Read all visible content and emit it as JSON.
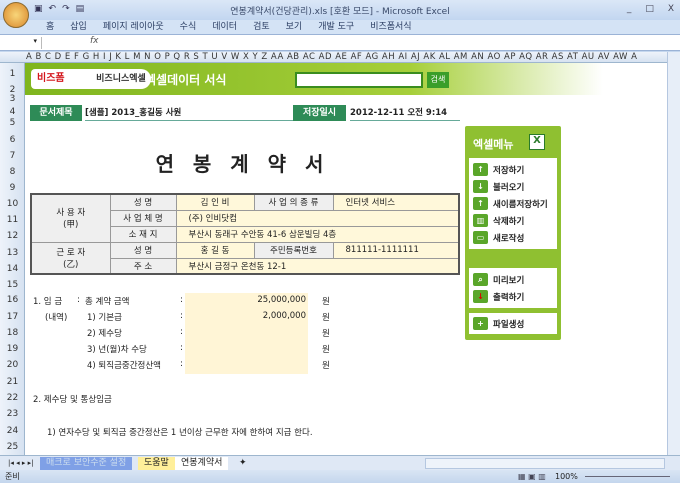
{
  "window": {
    "title": "연봉계약서(건당관리).xls  [호환 모드] - Microsoft Excel",
    "controls": [
      "_",
      "□",
      "X"
    ]
  },
  "ribbon": {
    "tabs": [
      "홈",
      "삽입",
      "페이지 레이아웃",
      "수식",
      "데이터",
      "검토",
      "보기",
      "개발 도구",
      "비즈폼서식"
    ]
  },
  "formula_bar": {
    "fx": "fx",
    "value": ""
  },
  "columns": "A B C D E F G H I J K L M N O P Q R S T U V W X Y Z AA AB AC AD AE AF AG AH AI AJ AK AL AM AN AO AP AQ AR AS AT AU AV AW A",
  "rows": [
    "1",
    "2",
    "3",
    "4",
    "5",
    "6",
    "7",
    "8",
    "9",
    "10",
    "11",
    "12",
    "13",
    "14",
    "15",
    "16",
    "17",
    "18",
    "19",
    "20",
    "21",
    "22",
    "23",
    "24",
    "25"
  ],
  "banner": {
    "logo1": "비즈폼",
    "logo2": "비즈니스엑셀",
    "title": "엑셀데이터 서식",
    "search_placeholder": "",
    "search_button": "검색"
  },
  "doc_info": {
    "title_label": "문서제목",
    "title_value": "[샘플] 2013_홍길동 사원",
    "saved_label": "저장일시",
    "saved_value": "2012-12-11  오전 9:14"
  },
  "doc_title": "연 봉 계 약 서",
  "parties": {
    "employer_label": "사 용 자",
    "employer_sub": "(甲)",
    "name_label": "성          명",
    "employer_name": "김 인 비",
    "biz_type_label": "사 업 의 종 류",
    "biz_type": "인터넷 서비스",
    "company_label": "사 업 체 명",
    "company": "(주) 인비닷컴",
    "location_label": "소    재    지",
    "location": "부산시 동래구 수안동 41-6 삼운빌딩 4층",
    "employee_label": "근 로 자",
    "employee_sub": "(乙)",
    "employee_name": "홍 길 동",
    "rrn_label": "주민등록번호",
    "rrn": "811111-1111111",
    "address_label": "주          소",
    "address": "부산시 금정구 온천동 12-1"
  },
  "wage": {
    "heading": "1. 임 금",
    "colon": ":",
    "total_label": "총 계약 금액",
    "detail_label": "(내역)",
    "unit": "원",
    "items": [
      {
        "label": "총 계약 금액",
        "value": "25,000,000"
      },
      {
        "label": "1) 기본급",
        "value": "2,000,000"
      },
      {
        "label": "2) 제수당",
        "value": ""
      },
      {
        "label": "3) 년(월)차 수당",
        "value": ""
      },
      {
        "label": "4) 퇴직금중간정산액",
        "value": ""
      }
    ]
  },
  "section2": {
    "heading": "2. 제수당 및 통상임금",
    "item1": "1) 연자수당 및 퇴직금 중간정산은 1 년이상 근무한 자에 한하여 지급 한다."
  },
  "menu": {
    "title": "엑셀메뉴",
    "items": [
      "저장하기",
      "불러오기",
      "새이름저장하기",
      "삭제하기",
      "새로작성",
      "미리보기",
      "출력하기",
      "파일생성"
    ]
  },
  "sheet_tabs": [
    "매크로 보안수준 설정",
    "도움말",
    "연봉계약서"
  ],
  "status": {
    "ready": "준비",
    "zoom": "100%"
  }
}
